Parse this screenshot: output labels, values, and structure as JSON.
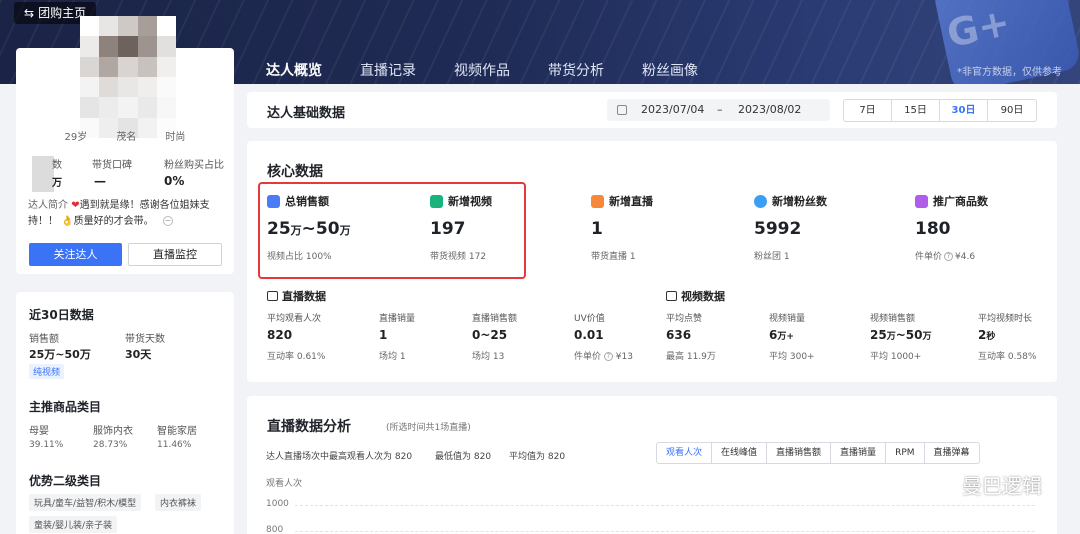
{
  "header": {
    "home_label": "团购主页",
    "tabs": [
      {
        "label": "达人概览",
        "active": true
      },
      {
        "label": "直播记录"
      },
      {
        "label": "视频作品"
      },
      {
        "label": "带货分析"
      },
      {
        "label": "粉丝画像"
      }
    ],
    "disclaimer": "*非官方数据，仅供参考",
    "deco_letters": "G+"
  },
  "profile": {
    "age": "29岁",
    "tag2": "茂名",
    "tag3": "时尚",
    "stat_labels": [
      "数",
      "带货口碑",
      "粉丝购买占比"
    ],
    "stat_values": [
      "万",
      "—",
      "0%"
    ],
    "intro_label": "达人简介",
    "intro_text_a": "遇到就是缘！感谢各位姐妹支持！！",
    "intro_text_b": "质量好的才会带。",
    "follow_label": "关注达人",
    "monitor_label": "直播监控"
  },
  "recent": {
    "title": "近30日数据",
    "sales_label": "销售额",
    "sales_value": "25万~50万",
    "days_label": "带货天数",
    "days_value": "30天",
    "tag": "纯视频"
  },
  "main_categories": {
    "title": "主推商品类目",
    "items": [
      {
        "name": "母婴",
        "pct": "39.11%"
      },
      {
        "name": "服饰内衣",
        "pct": "28.73%"
      },
      {
        "name": "智能家居",
        "pct": "11.46%"
      }
    ]
  },
  "sub_categories": {
    "title": "优势二级类目",
    "chips": [
      "玩具/童车/益智/积木/模型",
      "内衣裤袜",
      "童装/婴儿装/亲子装"
    ]
  },
  "basic": {
    "title": "达人基础数据",
    "date_start": "2023/07/04",
    "date_sep": "–",
    "date_end": "2023/08/02",
    "ranges": [
      {
        "label": "7日"
      },
      {
        "label": "15日"
      },
      {
        "label": "30日",
        "active": true
      },
      {
        "label": "90日"
      }
    ]
  },
  "core": {
    "title": "核心数据",
    "metrics": [
      {
        "label": "总销售额",
        "value_a": "25",
        "unit_a": "万",
        "value_b": "~50",
        "unit_b": "万",
        "sub": "视频占比 100%",
        "icon_color": "#4a7cf7"
      },
      {
        "label": "新增视频",
        "value": "197",
        "sub": "带货视频 172",
        "icon_color": "#19b47b"
      },
      {
        "label": "新增直播",
        "value": "1",
        "sub": "带货直播 1",
        "icon_color": "#f5883a"
      },
      {
        "label": "新增粉丝数",
        "value": "5992",
        "sub": "粉丝团 1",
        "icon_color": "#3b9ef5"
      },
      {
        "label": "推广商品数",
        "value": "180",
        "sub_a": "件单价",
        "sub_b": "¥4.6",
        "icon_color": "#b05de9"
      }
    ],
    "live": {
      "title": "直播数据",
      "items": [
        {
          "label": "平均观看人次",
          "value": "820",
          "sub": "互动率 0.61%"
        },
        {
          "label": "直播销量",
          "value": "1",
          "sub": "场均 1"
        },
        {
          "label": "直播销售额",
          "value": "0~25",
          "sub": "场均 13"
        },
        {
          "label": "UV价值",
          "value": "0.01",
          "sub_a": "件单价",
          "sub_b": "¥13"
        }
      ]
    },
    "video": {
      "title": "视频数据",
      "items": [
        {
          "label": "平均点赞",
          "value": "636",
          "sub": "最高 11.9万"
        },
        {
          "label": "视频销量",
          "value_a": "6",
          "unit_a": "万+",
          "sub": "平均 300+"
        },
        {
          "label": "视频销售额",
          "value_a": "25",
          "unit_a": "万",
          "value_b": "~50",
          "unit_b": "万",
          "sub": "平均 1000+"
        },
        {
          "label": "平均视频时长",
          "value_a": "2",
          "unit_a": "秒",
          "sub": "互动率 0.58%"
        }
      ]
    }
  },
  "analysis": {
    "title": "直播数据分析",
    "note": "(所选时间共1场直播)",
    "summary": [
      "达人直播场次中最高观看人次为 820",
      "最低值为 820",
      "平均值为 820"
    ],
    "metric_tabs": [
      {
        "label": "观看人次",
        "active": true
      },
      {
        "label": "在线峰值"
      },
      {
        "label": "直播销售额"
      },
      {
        "label": "直播销量"
      },
      {
        "label": "RPM"
      },
      {
        "label": "直播弹幕"
      }
    ],
    "y_label": "观看人次",
    "ticks": [
      "1000",
      "800"
    ]
  },
  "watermark": "曼巴逻辑"
}
